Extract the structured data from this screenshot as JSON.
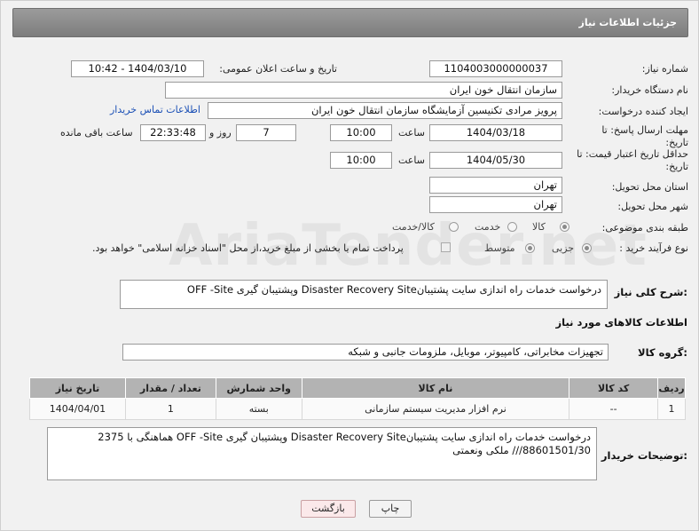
{
  "header": {
    "title": "جزئیات اطلاعات نیاز"
  },
  "watermark": "AriaTender.net",
  "fields": {
    "need_number": {
      "label": "شماره نیاز:",
      "value": "1104003000000037"
    },
    "announce_datetime": {
      "label": "تاریخ و ساعت اعلان عمومی:",
      "value": "1404/03/10 - 10:42"
    },
    "buyer_org": {
      "label": "نام دستگاه خریدار:",
      "value": "سازمان انتقال خون ایران"
    },
    "requester": {
      "label": "ایجاد کننده درخواست:",
      "value": "پرویز مرادی تکنیسین آزمایشگاه سازمان انتقال خون ایران",
      "contact_link": "اطلاعات تماس خریدار"
    },
    "reply_deadline": {
      "label": "مهلت ارسال پاسخ: تا تاریخ:",
      "date": "1404/03/18",
      "time_label": "ساعت",
      "time": "10:00",
      "days": "7",
      "days_label": "روز و",
      "remaining": "22:33:48",
      "remaining_label": "ساعت باقی مانده"
    },
    "price_validity": {
      "label": "حداقل تاریخ اعتبار قیمت: تا تاریخ:",
      "date": "1404/05/30",
      "time_label": "ساعت",
      "time": "10:00"
    },
    "delivery_province": {
      "label": "استان محل تحویل:",
      "value": "تهران"
    },
    "delivery_city": {
      "label": "شهر محل تحویل:",
      "value": "تهران"
    },
    "category": {
      "label": "طبقه بندی موضوعی:",
      "options": [
        "کالا",
        "خدمت",
        "کالا/خدمت"
      ],
      "selected": "کالا"
    },
    "process_type": {
      "label": "نوع فرآیند خرید :",
      "options": [
        "جزیی",
        "متوسط"
      ],
      "selected": "جزیی",
      "payment_note": "پرداخت تمام یا بخشی از مبلغ خرید،از محل \"اسناد خزانه اسلامی\" خواهد بود."
    }
  },
  "description": {
    "label": "شرح کلی نیاز:",
    "value": "درخواست خدمات راه اندازی سایت پشتیبانDisaster Recovery Site وپشتیبان گیری OFF -Site"
  },
  "goods_info": {
    "title": "اطلاعات کالاهای مورد نیاز"
  },
  "goods_group": {
    "label": "گروه کالا:",
    "value": "تجهیزات مخابراتی، کامپیوتر، موبایل، ملزومات جانبی و شبکه"
  },
  "table": {
    "headers": [
      "ردیف",
      "کد کالا",
      "نام کالا",
      "واحد شمارش",
      "تعداد / مقدار",
      "تاریخ نیاز"
    ],
    "rows": [
      [
        "1",
        "--",
        "نرم افزار مدیریت سیستم سازمانی",
        "بسته",
        "1",
        "1404/04/01"
      ]
    ]
  },
  "buyer_notes": {
    "label": "توضیحات خریدار:",
    "line1": "درخواست خدمات راه اندازی سایت پشتیبانDisaster Recovery Site وپشتیبان گیری OFF -Site هماهنگی با 2375",
    "line2": "88601501/30/// ملکی ونعمتی"
  },
  "buttons": {
    "print": "چاپ",
    "back": "بازگشت"
  },
  "colors": {
    "header": "#8a8a8a",
    "link": "#1a4fb5",
    "back_button": "#fbe9ea"
  }
}
